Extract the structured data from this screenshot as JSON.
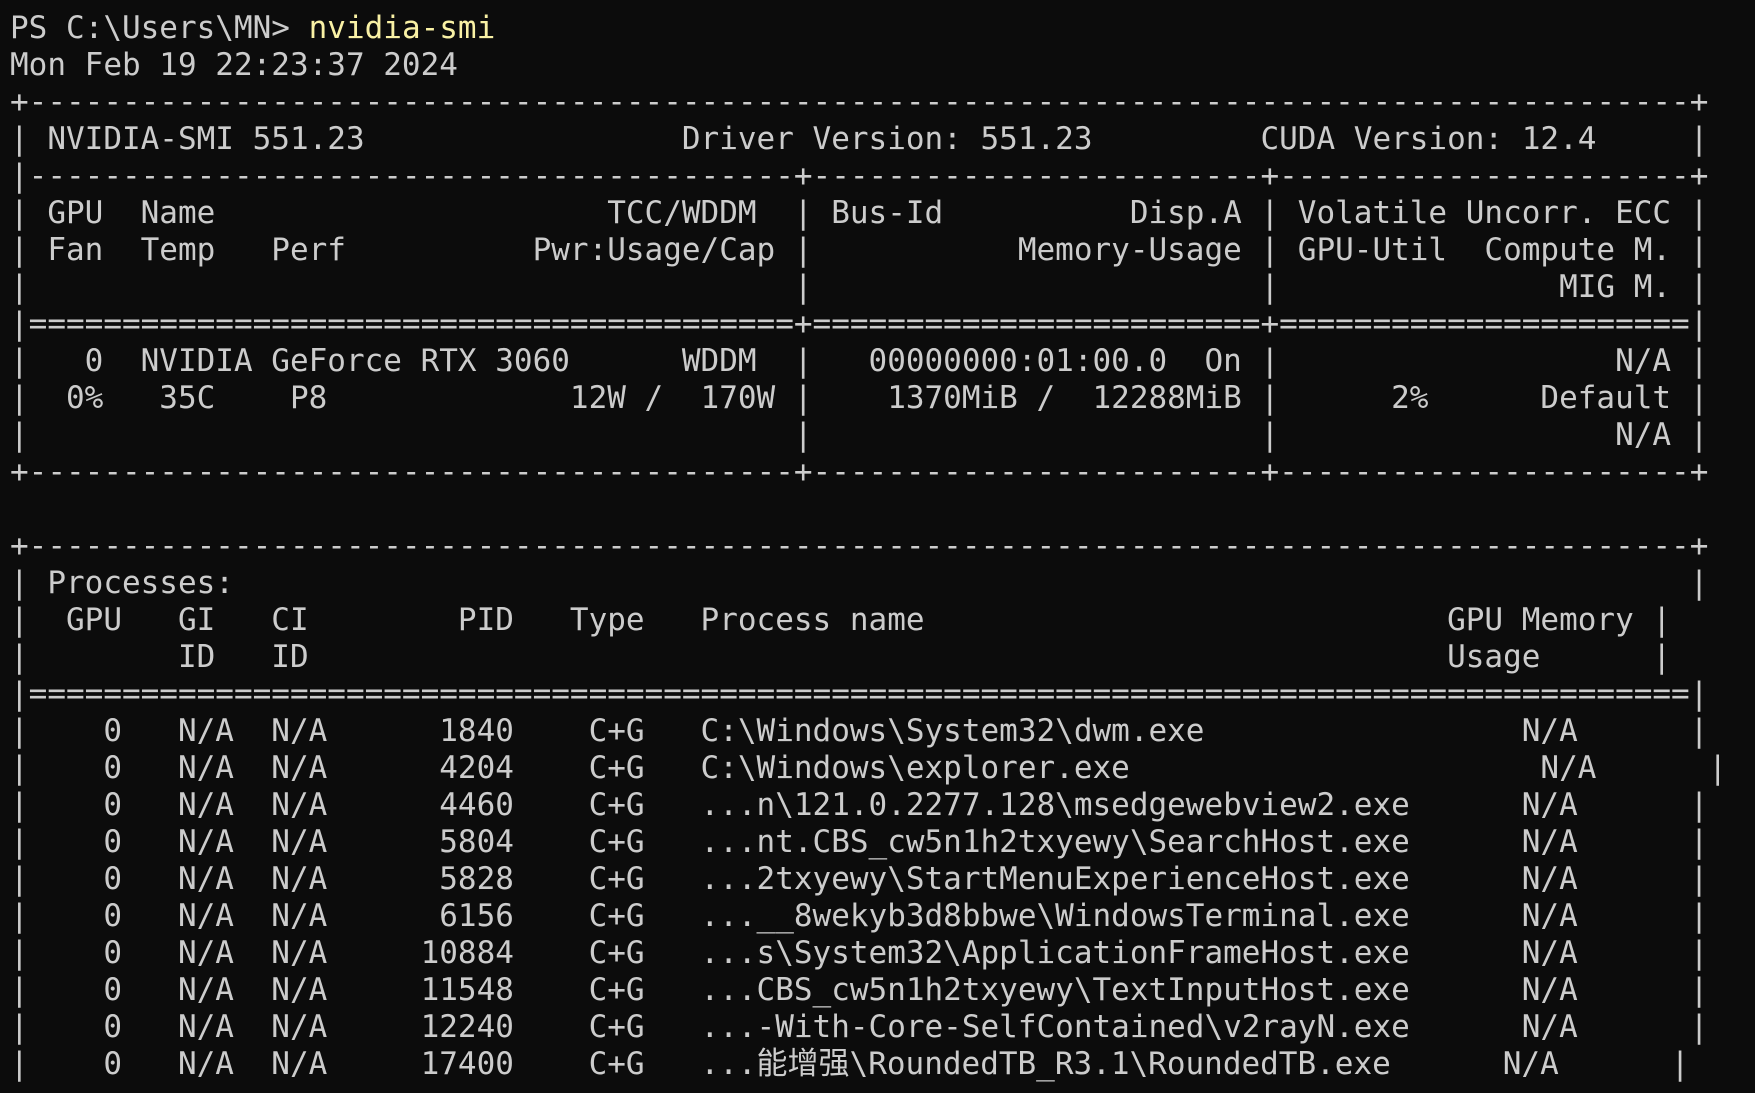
{
  "prompt": {
    "text": "PS C:\\Users\\MN> ",
    "command": "nvidia-smi"
  },
  "output_lines": [
    "Mon Feb 19 22:23:37 2024",
    "+-----------------------------------------------------------------------------------------+",
    "| NVIDIA-SMI 551.23                 Driver Version: 551.23         CUDA Version: 12.4     |",
    "|-----------------------------------------+------------------------+----------------------+",
    "| GPU  Name                     TCC/WDDM  | Bus-Id          Disp.A | Volatile Uncorr. ECC |",
    "| Fan  Temp   Perf          Pwr:Usage/Cap |           Memory-Usage | GPU-Util  Compute M. |",
    "|                                         |                        |               MIG M. |",
    "|=========================================+========================+======================|",
    "|   0  NVIDIA GeForce RTX 3060      WDDM  |   00000000:01:00.0  On |                  N/A |",
    "|  0%   35C    P8             12W /  170W |    1370MiB /  12288MiB |      2%      Default |",
    "|                                         |                        |                  N/A |",
    "+-----------------------------------------+------------------------+----------------------+",
    "",
    "+-----------------------------------------------------------------------------------------+",
    "| Processes:                                                                              |",
    "|  GPU   GI   CI        PID   Type   Process name                            GPU Memory |",
    "|        ID   ID                                                             Usage      |",
    "|=========================================================================================|",
    "|    0   N/A  N/A      1840    C+G   C:\\Windows\\System32\\dwm.exe                 N/A      |",
    "|    0   N/A  N/A      4204    C+G   C:\\Windows\\explorer.exe                      N/A      |",
    "|    0   N/A  N/A      4460    C+G   ...n\\121.0.2277.128\\msedgewebview2.exe      N/A      |",
    "|    0   N/A  N/A      5804    C+G   ...nt.CBS_cw5n1h2txyewy\\SearchHost.exe      N/A      |",
    "|    0   N/A  N/A      5828    C+G   ...2txyewy\\StartMenuExperienceHost.exe      N/A      |",
    "|    0   N/A  N/A      6156    C+G   ...__8wekyb3d8bbwe\\WindowsTerminal.exe      N/A      |",
    "|    0   N/A  N/A     10884    C+G   ...s\\System32\\ApplicationFrameHost.exe      N/A      |",
    "|    0   N/A  N/A     11548    C+G   ...CBS_cw5n1h2txyewy\\TextInputHost.exe      N/A      |",
    "|    0   N/A  N/A     12240    C+G   ...-With-Core-SelfContained\\v2rayN.exe      N/A      |",
    "|    0   N/A  N/A     17400    C+G   ...能增强\\RoundedTB_R3.1\\RoundedTB.exe      N/A      |"
  ]
}
